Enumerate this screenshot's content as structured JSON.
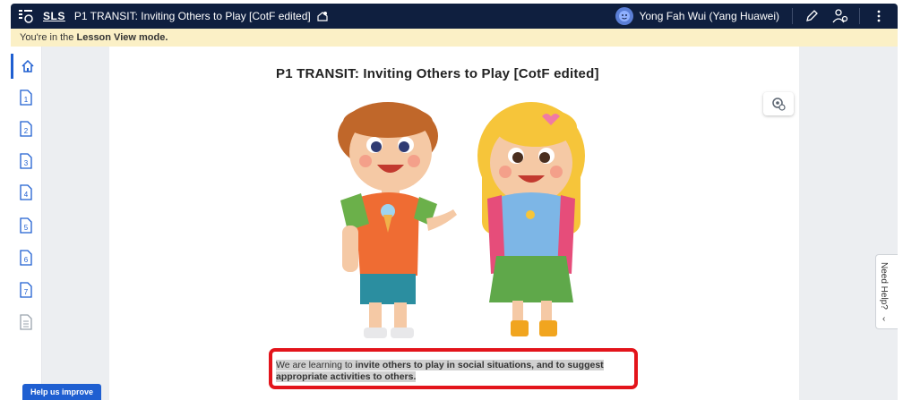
{
  "header": {
    "logo_text": "SLS",
    "lesson_title": "P1 TRANSIT: Inviting Others to Play [CotF edited]",
    "user_name": "Yong Fah Wui (Yang Huawei)",
    "icons": [
      "menu-grid-icon",
      "share-icon",
      "avatar",
      "pencil-icon",
      "people-settings-icon",
      "more-vertical-icon"
    ]
  },
  "mode_bar": {
    "prefix": "You're in the ",
    "mode": "Lesson View mode."
  },
  "nav": {
    "items": [
      {
        "name": "home",
        "label": ""
      },
      {
        "name": "page-1",
        "label": "1"
      },
      {
        "name": "page-2",
        "label": "2"
      },
      {
        "name": "page-3",
        "label": "3"
      },
      {
        "name": "page-4",
        "label": "4"
      },
      {
        "name": "page-5",
        "label": "5"
      },
      {
        "name": "page-6",
        "label": "6"
      },
      {
        "name": "page-7",
        "label": "7"
      },
      {
        "name": "summary",
        "label": ""
      }
    ]
  },
  "main": {
    "title": "P1 TRANSIT: Inviting Others to Play [CotF edited]",
    "objective_prefix": "We are learning to ",
    "objective_bold": "invite others to play in social situations, and to suggest appropriate activities to others."
  },
  "help_tab": {
    "label": "Need Help?",
    "chevron": "‹"
  },
  "improve_button": {
    "label": "Help us improve"
  },
  "colors": {
    "topbar": "#0f1f3f",
    "modebar": "#fbf0c6",
    "accent": "#1f5fd1",
    "highlight_box": "#e3141b"
  }
}
